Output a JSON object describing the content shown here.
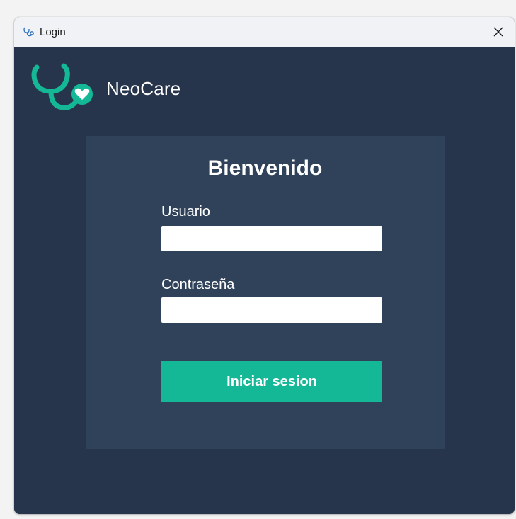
{
  "window": {
    "title": "Login",
    "icon": "stethoscope-icon",
    "close_icon": "close-icon"
  },
  "brand": {
    "name": "NeoCare",
    "logo_icon": "stethoscope-heart-icon",
    "accent_color": "#14b896"
  },
  "login": {
    "heading": "Bienvenido",
    "username_label": "Usuario",
    "username_value": "",
    "password_label": "Contraseña",
    "password_value": "",
    "submit_label": "Iniciar sesion"
  },
  "colors": {
    "background": "#26354b",
    "panel": "#2f4259",
    "button": "#14b896",
    "titlebar": "#f0f2f5"
  }
}
